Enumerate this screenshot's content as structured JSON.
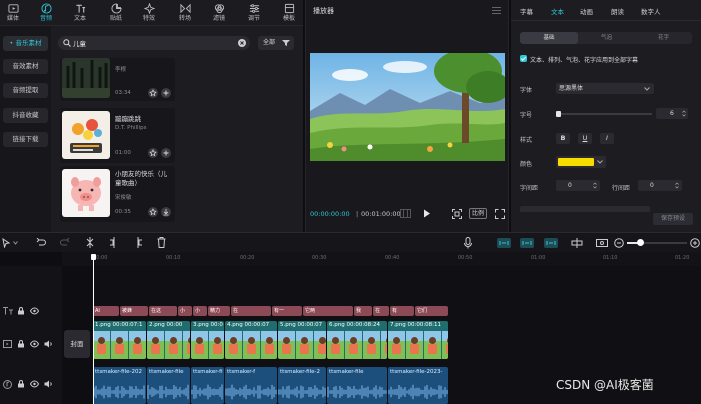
{
  "toolbar": {
    "items": [
      {
        "label": "媒体",
        "icon": "media-icon",
        "active": false
      },
      {
        "label": "音频",
        "icon": "music-icon",
        "active": true
      },
      {
        "label": "文本",
        "icon": "text-icon",
        "active": false
      },
      {
        "label": "贴纸",
        "icon": "sticker-icon",
        "active": false
      },
      {
        "label": "特效",
        "icon": "sparkle-icon",
        "active": false
      },
      {
        "label": "转场",
        "icon": "transition-icon",
        "active": false
      },
      {
        "label": "滤镜",
        "icon": "filter-icon",
        "active": false
      },
      {
        "label": "调节",
        "icon": "adjust-icon",
        "active": false
      },
      {
        "label": "模板",
        "icon": "template-icon",
        "active": false
      }
    ]
  },
  "sidenav": {
    "items": [
      {
        "label": "• 音乐素材",
        "active": true
      },
      {
        "label": "音效素材",
        "active": false
      },
      {
        "label": "音频提取",
        "active": false
      },
      {
        "label": "抖音收藏",
        "active": false
      },
      {
        "label": "链接下载",
        "active": false
      }
    ]
  },
  "search": {
    "value": "儿童",
    "filter_label": "全部"
  },
  "audio_list": [
    {
      "title": "",
      "artist": "李根",
      "duration": "03:34"
    },
    {
      "title": "蹦蹦跳跳",
      "artist": "D.T. Phillips",
      "duration": "01:00"
    },
    {
      "title": "小朋友的快乐（儿童歌曲）",
      "artist": "宋俊敏",
      "duration": "00:35"
    }
  ],
  "player": {
    "title": "播放器",
    "current_time": "00:00:00:00",
    "total_time": "00:01:00:00",
    "ratio_label": "比例"
  },
  "props": {
    "tabs": [
      {
        "label": "字幕",
        "active": false
      },
      {
        "label": "文本",
        "active": true
      },
      {
        "label": "动画",
        "active": false
      },
      {
        "label": "朗读",
        "active": false
      },
      {
        "label": "数字人",
        "active": false
      }
    ],
    "sub_tabs": [
      {
        "label": "基础",
        "active": true
      },
      {
        "label": "气泡",
        "active": false
      },
      {
        "label": "花字",
        "active": false
      }
    ],
    "apply_all": "文本、排列、气泡、花字应用到全部字幕",
    "font_label": "字体",
    "font_value": "思源黑体",
    "size_label": "字号",
    "size_value": "6",
    "style_label": "样式",
    "style_buttons": [
      "B",
      "U",
      "I"
    ],
    "color_label": "颜色",
    "color_value": "#f7dc00",
    "spacing_label": "字间距",
    "spacing_value": "0",
    "line_label": "行间距",
    "line_value": "0",
    "preset_btn": "保存预设"
  },
  "timeline": {
    "ruler": [
      "00:00",
      "00:10",
      "00:20",
      "00:30",
      "00:40",
      "00:50",
      "01:00",
      "01:10",
      "01:20"
    ],
    "cover_label": "封面",
    "text_clips": [
      {
        "label": "AI"
      },
      {
        "label": "被蜂"
      },
      {
        "label": "在这"
      },
      {
        "label": "小"
      },
      {
        "label": "小"
      },
      {
        "label": "精力"
      },
      {
        "label": "在"
      },
      {
        "label": "有一"
      },
      {
        "label": "它两"
      },
      {
        "label": "我"
      },
      {
        "label": "在"
      },
      {
        "label": "有"
      },
      {
        "label": "它们"
      }
    ],
    "video_clips": [
      {
        "name": "1.png",
        "dur": "00:00:07:1"
      },
      {
        "name": "2.png",
        "dur": "00:00"
      },
      {
        "name": "3.png",
        "dur": "00:0"
      },
      {
        "name": "4.png",
        "dur": "00:00:07"
      },
      {
        "name": "5.png",
        "dur": "00:00:07"
      },
      {
        "name": "6.png",
        "dur": "00:00:08:24"
      },
      {
        "name": "7.png",
        "dur": "00:00:08:11"
      }
    ],
    "audio_clips": [
      {
        "name": "ttsmaker-file-202"
      },
      {
        "name": "ttsmaker-file"
      },
      {
        "name": "ttsmaker-fi"
      },
      {
        "name": "ttsmaker-f"
      },
      {
        "name": "ttsmaker-file-2"
      },
      {
        "name": "ttsmaker-file"
      },
      {
        "name": "ttsmaker-file-2023-"
      }
    ]
  },
  "watermark": "CSDN @AI极客菌"
}
